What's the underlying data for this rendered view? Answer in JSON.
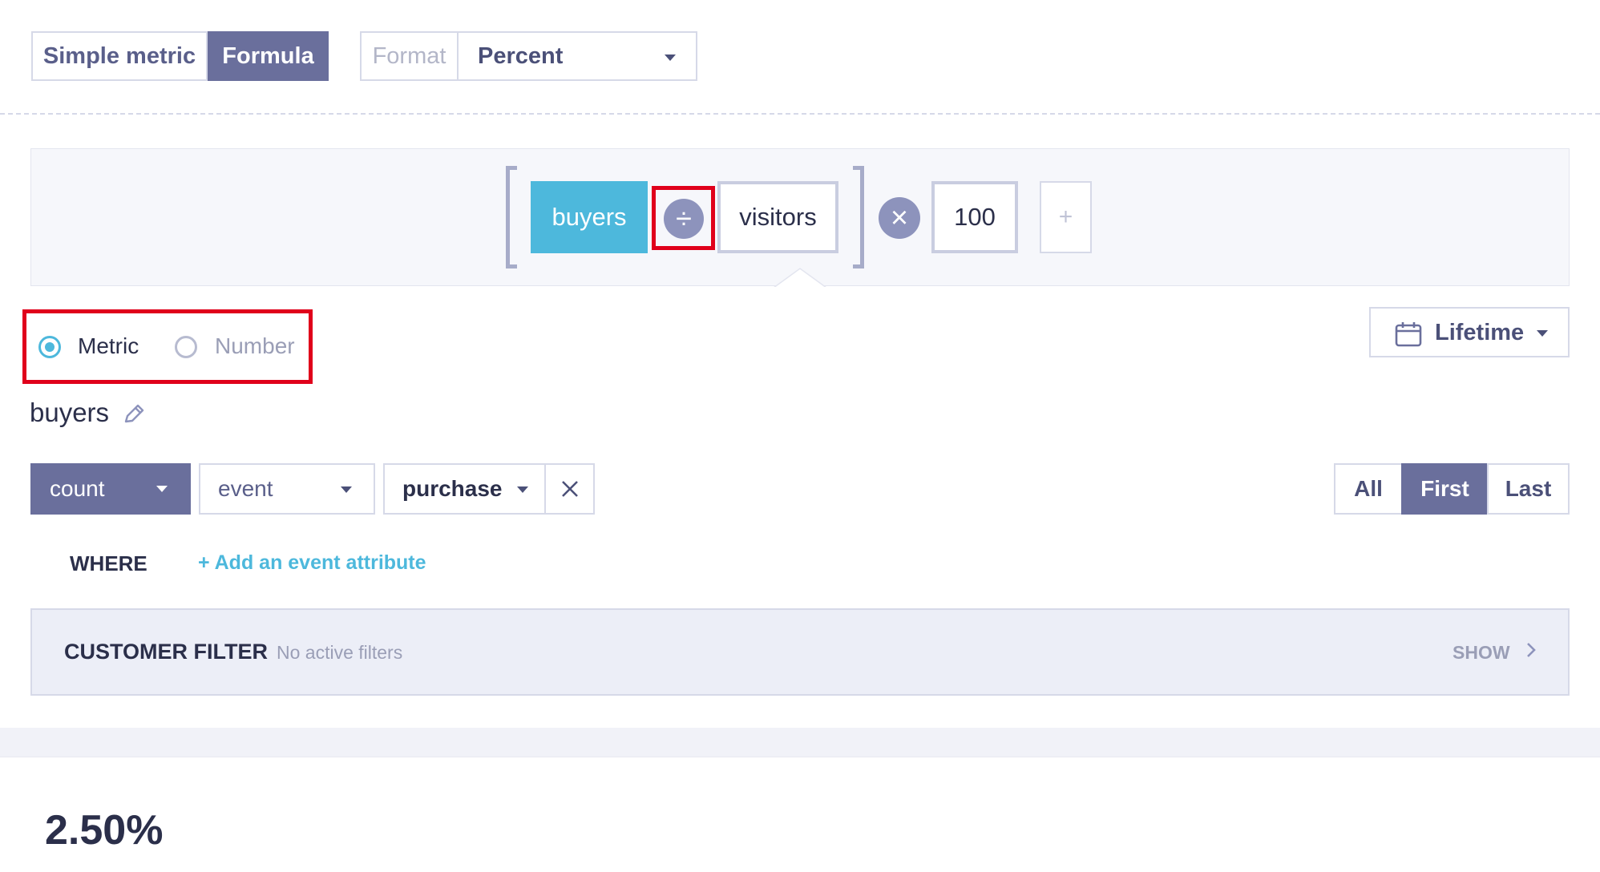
{
  "mode_toggle": {
    "simple_label": "Simple metric",
    "formula_label": "Formula",
    "active": "Formula"
  },
  "format": {
    "label": "Format",
    "value": "Percent"
  },
  "formula": {
    "first_token": "buyers",
    "operator_divide": "÷",
    "second_token": "visitors",
    "operator_multiply": "×",
    "constant": "100",
    "add": "+"
  },
  "operand_type": {
    "metric_label": "Metric",
    "number_label": "Number",
    "selected": "Metric"
  },
  "date_range": {
    "value": "Lifetime",
    "icon": "calendar-icon"
  },
  "metric": {
    "name": "buyers",
    "aggregation": "count",
    "source": "event",
    "event_name": "purchase",
    "occurrence_options": [
      "All",
      "First",
      "Last"
    ],
    "occurrence_selected": "First"
  },
  "where": {
    "label": "WHERE",
    "add_attribute": "+ Add an event attribute"
  },
  "customer_filter": {
    "title": "CUSTOMER FILTER",
    "status": "No active filters",
    "toggle": "SHOW"
  },
  "result": {
    "value": "2.50%"
  },
  "colors": {
    "accent": "#4db8dc",
    "primary": "#6a6f9c",
    "highlight": "#e0001b"
  }
}
